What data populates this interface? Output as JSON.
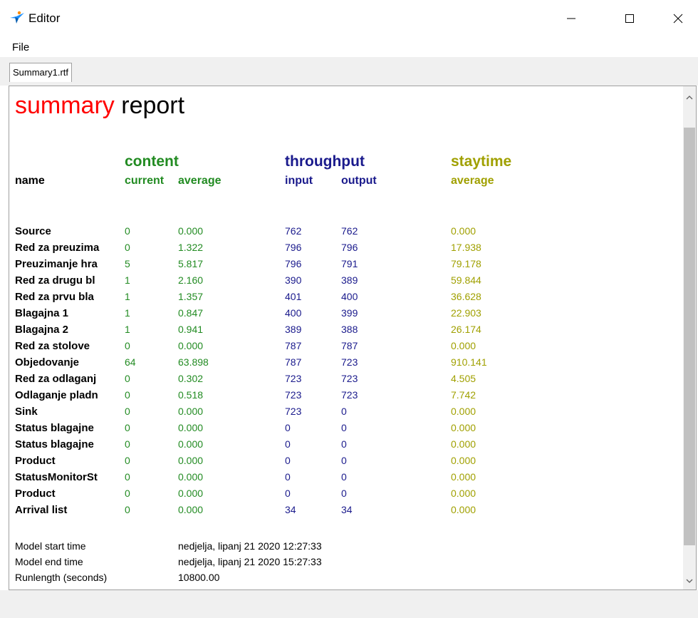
{
  "window": {
    "title": "Editor",
    "icon": "app-bird-icon",
    "controls": [
      "minimize-icon",
      "maximize-icon",
      "close-icon"
    ]
  },
  "menu": {
    "file": "File"
  },
  "tabs": [
    {
      "label": "Summary1.rtf"
    }
  ],
  "report": {
    "title_part1": "summary",
    "title_part2": "report",
    "colors": {
      "title_red": "#ff0000",
      "content": "#228b22",
      "throughput": "#1a1a8c",
      "staytime": "#a0a000"
    },
    "headers": {
      "name": "name",
      "content": "content",
      "current": "current",
      "average": "average",
      "throughput": "throughput",
      "input": "input",
      "output": "output",
      "staytime": "staytime",
      "stay_average": "average"
    },
    "rows": [
      {
        "name": "Source",
        "current": "0",
        "average": "0.000",
        "input": "762",
        "output": "762",
        "staytime": "0.000"
      },
      {
        "name": "Red za preuzima",
        "current": "0",
        "average": "1.322",
        "input": "796",
        "output": "796",
        "staytime": "17.938"
      },
      {
        "name": "Preuzimanje hra",
        "current": "5",
        "average": "5.817",
        "input": "796",
        "output": "791",
        "staytime": "79.178"
      },
      {
        "name": "Red za drugu bl",
        "current": "1",
        "average": "2.160",
        "input": "390",
        "output": "389",
        "staytime": "59.844"
      },
      {
        "name": "Red za prvu bla",
        "current": "1",
        "average": "1.357",
        "input": "401",
        "output": "400",
        "staytime": "36.628"
      },
      {
        "name": "Blagajna 1",
        "current": "1",
        "average": "0.847",
        "input": "400",
        "output": "399",
        "staytime": "22.903"
      },
      {
        "name": "Blagajna 2",
        "current": "1",
        "average": "0.941",
        "input": "389",
        "output": "388",
        "staytime": "26.174"
      },
      {
        "name": "Red za stolove",
        "current": "0",
        "average": "0.000",
        "input": "787",
        "output": "787",
        "staytime": "0.000"
      },
      {
        "name": "Objedovanje",
        "current": "64",
        "average": "63.898",
        "input": "787",
        "output": "723",
        "staytime": "910.141"
      },
      {
        "name": "Red za odlaganj",
        "current": "0",
        "average": "0.302",
        "input": "723",
        "output": "723",
        "staytime": "4.505"
      },
      {
        "name": "Odlaganje pladn",
        "current": "0",
        "average": "0.518",
        "input": "723",
        "output": "723",
        "staytime": "7.742"
      },
      {
        "name": "Sink",
        "current": "0",
        "average": "0.000",
        "input": "723",
        "output": "0",
        "staytime": "0.000"
      },
      {
        "name": "Status blagajne",
        "current": "0",
        "average": "0.000",
        "input": "0",
        "output": "0",
        "staytime": "0.000"
      },
      {
        "name": "Status blagajne",
        "current": "0",
        "average": "0.000",
        "input": "0",
        "output": "0",
        "staytime": "0.000"
      },
      {
        "name": "Product",
        "current": "0",
        "average": "0.000",
        "input": "0",
        "output": "0",
        "staytime": "0.000"
      },
      {
        "name": "StatusMonitorSt",
        "current": "0",
        "average": "0.000",
        "input": "0",
        "output": "0",
        "staytime": "0.000"
      },
      {
        "name": "Product",
        "current": "0",
        "average": "0.000",
        "input": "0",
        "output": "0",
        "staytime": "0.000"
      },
      {
        "name": "Arrival list",
        "current": "0",
        "average": "0.000",
        "input": "34",
        "output": "34",
        "staytime": "0.000"
      }
    ],
    "footer": [
      {
        "label": "Model start time",
        "value": "nedjelja, lipanj 21 2020 12:27:33"
      },
      {
        "label": "Model end  time",
        "value": "nedjelja, lipanj 21 2020 15:27:33"
      },
      {
        "label": "Runlength (seconds)",
        "value": "10800.00"
      }
    ]
  }
}
